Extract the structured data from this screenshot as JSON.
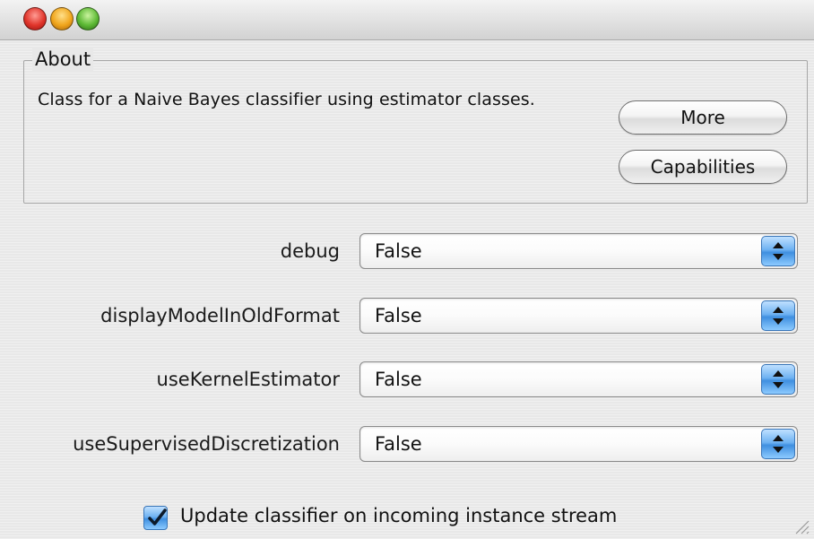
{
  "about": {
    "legend": "About",
    "description": "Class for a Naive Bayes classifier using estimator classes.",
    "more_button": "More",
    "capabilities_button": "Capabilities"
  },
  "properties": [
    {
      "label": "debug",
      "value": "False"
    },
    {
      "label": "displayModelInOldFormat",
      "value": "False"
    },
    {
      "label": "useKernelEstimator",
      "value": "False"
    },
    {
      "label": "useSupervisedDiscretization",
      "value": "False"
    }
  ],
  "update_checkbox": {
    "label": "Update classifier on incoming instance stream",
    "checked": true
  },
  "icons": {
    "close": "close-traffic-light-icon",
    "minimize": "minimize-traffic-light-icon",
    "zoom": "zoom-traffic-light-icon",
    "stepper": "up-down-stepper-icon",
    "checkmark": "checkmark-icon",
    "resize": "resize-grip-icon"
  },
  "colors": {
    "window_bg": "#e8e8e8",
    "aqua_blue": "#3f8fe0",
    "close_red": "#e0352b",
    "minimize_yellow": "#f0a51c",
    "zoom_green": "#5db935"
  }
}
